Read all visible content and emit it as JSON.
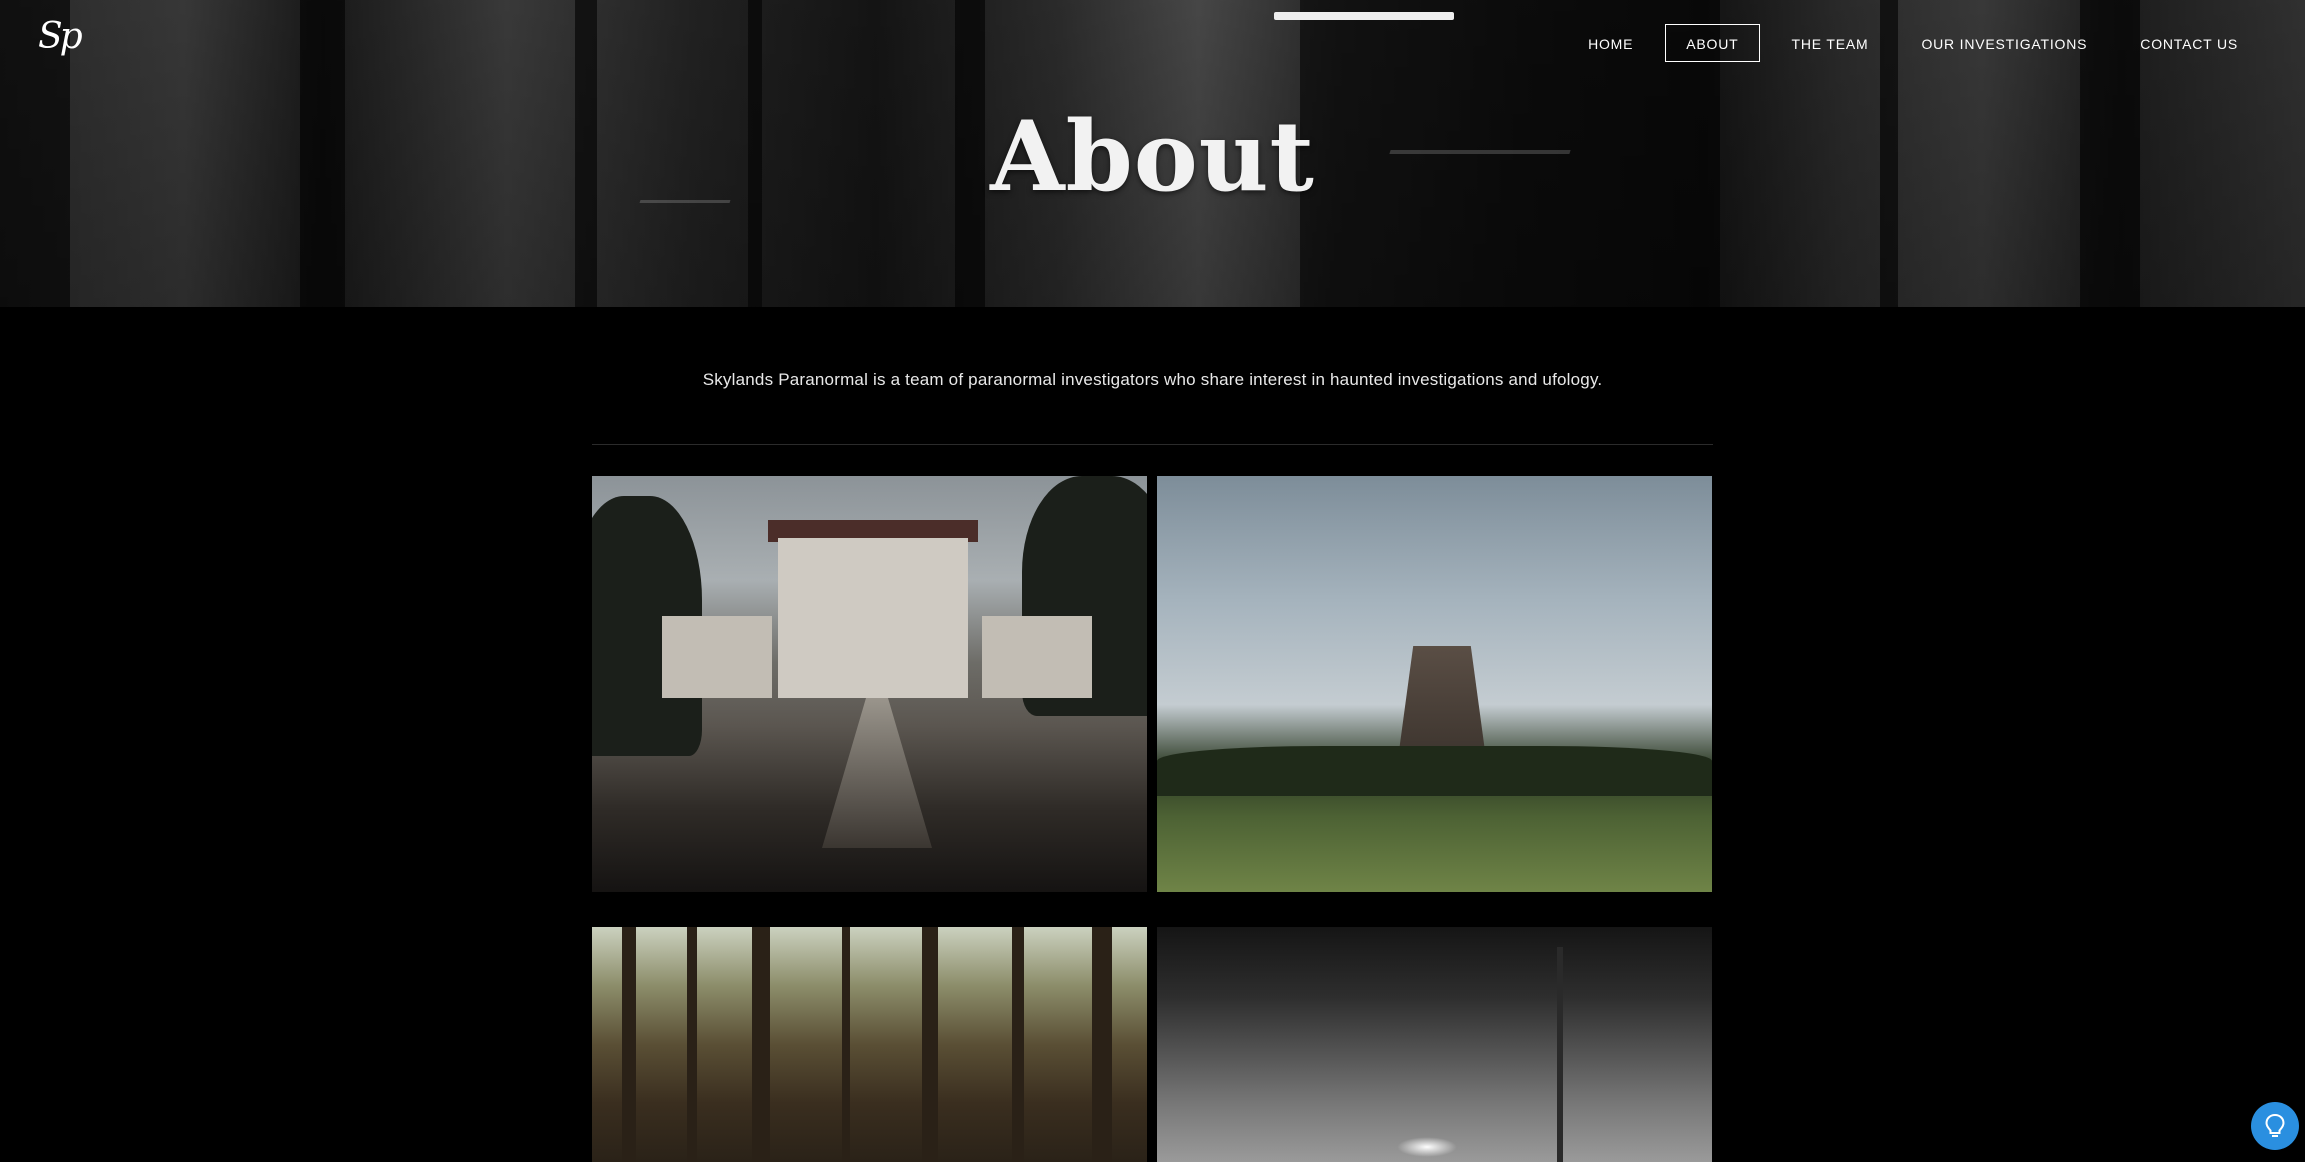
{
  "logo": {
    "text": "Sp"
  },
  "nav": {
    "items": [
      {
        "label": "HOME",
        "active": false
      },
      {
        "label": "ABOUT",
        "active": true
      },
      {
        "label": "THE TEAM",
        "active": false
      },
      {
        "label": "OUR INVESTIGATIONS",
        "active": false
      },
      {
        "label": "CONTACT US",
        "active": false
      }
    ]
  },
  "hero": {
    "title": "About"
  },
  "intro": {
    "text": "Skylands Paranormal is a team of paranormal investigators who share interest in haunted investigations and ufology."
  },
  "gallery": {
    "photos": [
      {
        "name": "mansion-photo"
      },
      {
        "name": "rock-tower-photo"
      },
      {
        "name": "forest-photo"
      },
      {
        "name": "foggy-road-photo"
      }
    ]
  },
  "help_button": {
    "icon": "lightbulb-icon",
    "color": "#2a8fe0"
  }
}
